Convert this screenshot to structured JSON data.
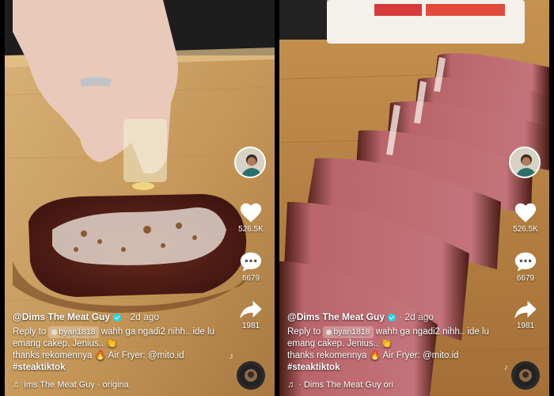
{
  "panels": [
    {
      "username": "@Dims The Meat Guy",
      "time_ago": "· 2d ago",
      "caption": {
        "reply_prefix": "Reply to",
        "reply_user": "byan1818",
        "reply_text": "wahh ga ngadi2 nihh.. ide lu emang cakep. Jenius..",
        "thanks_line": "thanks rekomennya",
        "air_fryer": "Air Fryer: @mito.id",
        "hashtag": "#steaktiktok"
      },
      "likes": "526.5K",
      "comments": "6679",
      "shares": "1981",
      "music": "ims The Meat Guy · origina"
    },
    {
      "username": "@Dims The Meat Guy",
      "time_ago": "· 2d ago",
      "caption": {
        "reply_prefix": "Reply to",
        "reply_user": "byan1818",
        "reply_text": "wahh ga ngadi2 nihh.. ide lu emang cakep. Jenius..",
        "thanks_line": "thanks rekomennya",
        "air_fryer": "Air Fryer: @mito.id",
        "hashtag": "#steaktiktok"
      },
      "likes": "526.5K",
      "comments": "6679",
      "shares": "1981",
      "music": "· Dims The Meat Guy   ori"
    }
  ],
  "icons": {
    "like": "heart-icon",
    "comment": "comment-icon",
    "share": "share-icon",
    "music": "music-note-icon",
    "verified": "verified-badge-icon"
  },
  "colors": {
    "verified": "#20d5ec",
    "board": "#c79a5e",
    "steak_crust": "#5a2417",
    "steak_inside": "#c26a6e"
  }
}
